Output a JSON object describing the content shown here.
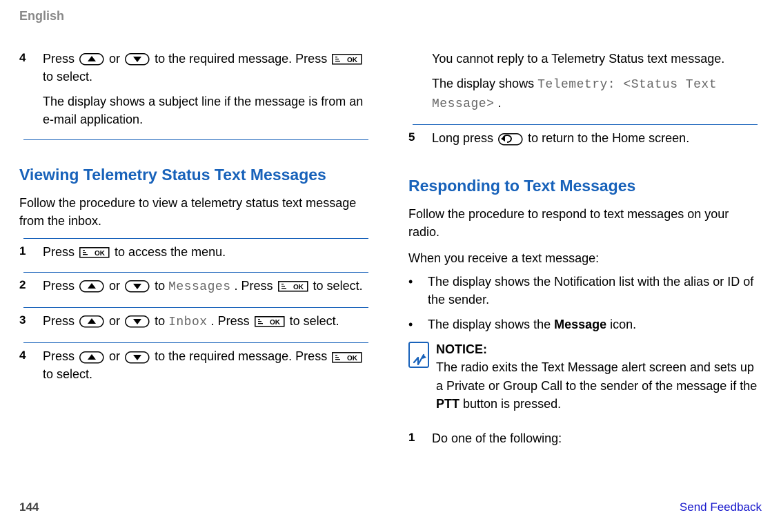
{
  "header": {
    "language": "English"
  },
  "left": {
    "topstep": {
      "num": "4",
      "line1_a": "Press ",
      "line1_b": " or ",
      "line1_c": " to the required message. Press ",
      "line1_d": " to select.",
      "line2": "The display shows a subject line if the message is from an e-mail application."
    },
    "section": {
      "title": "Viewing Telemetry Status Text Messages",
      "intro": "Follow the procedure to view a telemetry status text message from the inbox.",
      "steps": [
        {
          "num": "1",
          "a": "Press ",
          "b": " to access the menu."
        },
        {
          "num": "2",
          "a": "Press ",
          "b": " or ",
          "c": " to ",
          "mono": "Messages",
          "d": ". Press ",
          "e": " to select."
        },
        {
          "num": "3",
          "a": "Press ",
          "b": " or ",
          "c": " to ",
          "mono": "Inbox",
          "d": ". Press ",
          "e": " to select."
        },
        {
          "num": "4",
          "a": "Press ",
          "b": " or ",
          "c": " to the required message. Press ",
          "d": " to select."
        }
      ]
    }
  },
  "right": {
    "topbody": {
      "line1": "You cannot reply to a Telemetry Status text message.",
      "line2_a": "The display shows ",
      "mono": "Telemetry: <Status Text Message>",
      "line2_b": "."
    },
    "step5": {
      "num": "5",
      "a": "Long press ",
      "b": " to return to the Home screen."
    },
    "section": {
      "title": "Responding to Text Messages",
      "intro": "Follow the procedure to respond to text messages on your radio.",
      "lead": "When you receive a text message:",
      "bullets": [
        "The display shows the Notification list with the alias or ID of the sender.",
        "The display shows the Message icon."
      ],
      "bullet_word": "Message",
      "notice_label": "NOTICE:",
      "notice_body_a": "The radio exits the Text Message alert screen and sets up a Private or Group Call to the sender of the message if the ",
      "notice_body_ptt": "PTT",
      "notice_body_b": " button is pressed.",
      "step1": {
        "num": "1",
        "txt": "Do one of the following:"
      }
    }
  },
  "footer": {
    "page": "144",
    "feedback": "Send Feedback"
  }
}
